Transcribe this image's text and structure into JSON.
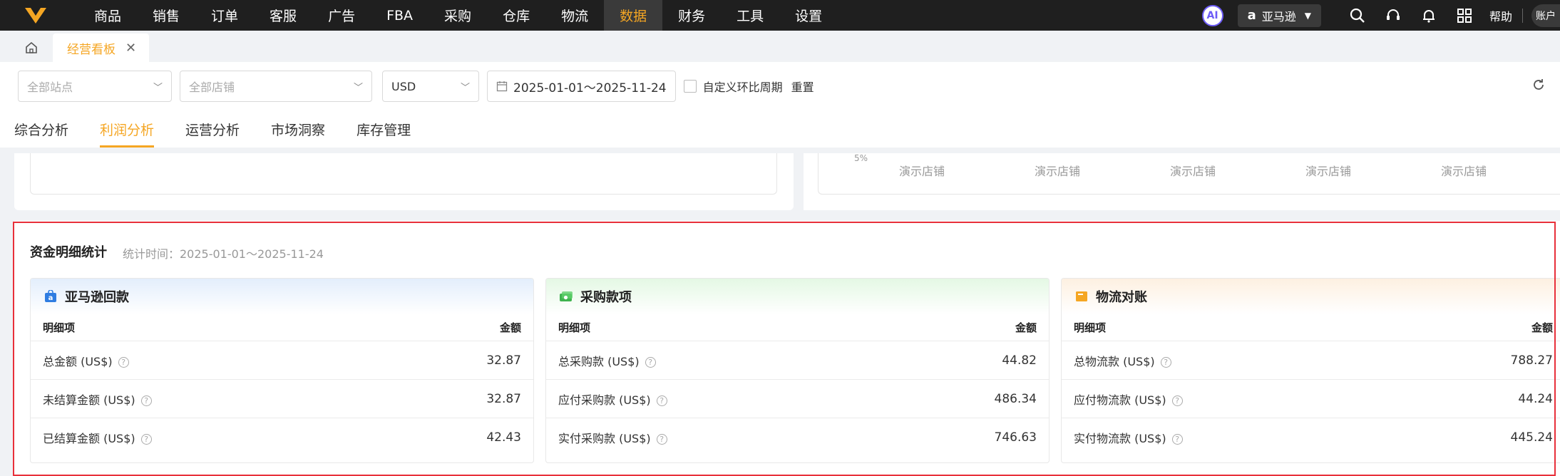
{
  "nav": {
    "items": [
      "商品",
      "销售",
      "订单",
      "客服",
      "广告",
      "FBA",
      "采购",
      "仓库",
      "物流",
      "数据",
      "财务",
      "工具",
      "设置"
    ],
    "active": "数据",
    "ai_label": "AI",
    "store_name": "亚马逊",
    "help_label": "帮助",
    "account_label": "账户"
  },
  "tabbar": {
    "current_tab": "经营看板"
  },
  "filters": {
    "site_placeholder": "全部站点",
    "shop_placeholder": "全部店铺",
    "currency": "USD",
    "date_range": "2025-01-01～2025-11-24",
    "custom_compare_label": "自定义环比周期",
    "reset_label": "重置"
  },
  "subtabs": {
    "items": [
      "综合分析",
      "利润分析",
      "运营分析",
      "市场洞察",
      "库存管理"
    ],
    "active": "利润分析"
  },
  "chart_fragment": {
    "axis_fragment": "5%",
    "x_labels": [
      "演示店铺",
      "演示店铺",
      "演示店铺",
      "演示店铺",
      "演示店铺"
    ]
  },
  "fund_detail": {
    "title": "资金明细统计",
    "stat_time": "统计时间：2025-01-01～2025-11-24",
    "cards": [
      {
        "title": "亚马逊回款",
        "icon": "amazon-bag-icon",
        "col_item": "明细项",
        "col_amount": "金额",
        "rows": [
          {
            "label": "总金额 (US$)",
            "value": "32.87"
          },
          {
            "label": "未结算金额 (US$)",
            "value": "32.87"
          },
          {
            "label": "已结算金额 (US$)",
            "value": "42.43"
          }
        ]
      },
      {
        "title": "采购款项",
        "icon": "money-icon",
        "col_item": "明细项",
        "col_amount": "金额",
        "rows": [
          {
            "label": "总采购款 (US$)",
            "value": "44.82"
          },
          {
            "label": "应付采购款 (US$)",
            "value": "486.34"
          },
          {
            "label": "实付采购款 (US$)",
            "value": "746.63"
          }
        ]
      },
      {
        "title": "物流对账",
        "icon": "box-icon",
        "col_item": "明细项",
        "col_amount": "金额",
        "rows": [
          {
            "label": "总物流款 (US$)",
            "value": "788.27"
          },
          {
            "label": "应付物流款 (US$)",
            "value": "44.24"
          },
          {
            "label": "实付物流款 (US$)",
            "value": "445.24"
          }
        ]
      }
    ]
  },
  "colors": {
    "accent": "#f5a623",
    "highlight_border": "#e8303a",
    "nav_bg": "#1f1f1f"
  }
}
